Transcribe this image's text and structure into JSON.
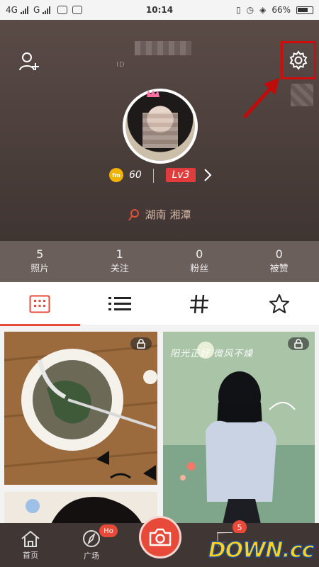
{
  "status_bar": {
    "net1": "4G",
    "net2": "G",
    "time": "10:14",
    "battery": "66%"
  },
  "profile": {
    "id_text": "ID",
    "coins": "60",
    "level": "Lv3",
    "location": "湖南 湘潭"
  },
  "stats": [
    {
      "value": "5",
      "label": "照片"
    },
    {
      "value": "1",
      "label": "关注"
    },
    {
      "value": "0",
      "label": "粉丝"
    },
    {
      "value": "0",
      "label": "被赞"
    }
  ],
  "tabs": [
    {
      "name": "grid",
      "icon": "grid-icon",
      "active": true
    },
    {
      "name": "list",
      "icon": "list-icon",
      "active": false
    },
    {
      "name": "topics",
      "icon": "hashtag-icon",
      "active": false
    },
    {
      "name": "favorites",
      "icon": "star-icon",
      "active": false
    }
  ],
  "photos": {
    "overlay_text": "阳光正好 微风不燥"
  },
  "bottom_nav": {
    "home_label": "首页",
    "square_label": "广场",
    "hot_badge": "Ho",
    "message_badge": "5",
    "watermark": "DOWN.cc"
  },
  "colors": {
    "accent": "#e84a3a",
    "header_bg": "#4d403d",
    "annotation": "#d10a0a"
  }
}
